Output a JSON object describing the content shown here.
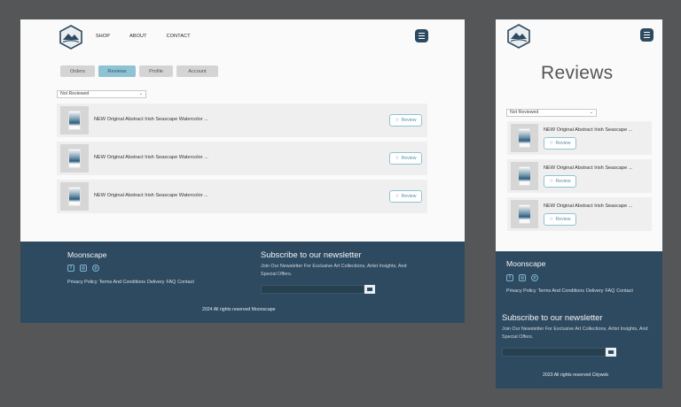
{
  "colors": {
    "accent": "#8fc3d3",
    "footer": "#2e4a60",
    "canvas": "#555657",
    "icon": "#7fb4d2"
  },
  "desktop": {
    "logo_icon": "mountain-hexagon-logo",
    "nav": [
      "SHOP",
      "ABOUT",
      "CONTACT"
    ],
    "menu_icon": "hamburger-icon",
    "tabs": [
      {
        "label": "Orders",
        "active": false
      },
      {
        "label": "Reviews",
        "active": true
      },
      {
        "label": "Profile",
        "active": false
      },
      {
        "label": "Account",
        "active": false
      }
    ],
    "filter": {
      "selected": "Not Reviewed"
    },
    "items": [
      {
        "title": "NEW Original Abstract Irish Seascape Watercolor ...",
        "action": "Review"
      },
      {
        "title": "NEW Original Abstract Irish Seascape Watercolor ...",
        "action": "Review"
      },
      {
        "title": "NEW Original Abstract Irish Seascape Watercolor ...",
        "action": "Review"
      }
    ],
    "footer": {
      "brand": "Moonscape",
      "social_icons": [
        "facebook-icon",
        "instagram-icon",
        "pinterest-icon"
      ],
      "links": [
        "Privacy Policy",
        "Terms And Conditions",
        "Delivery",
        "FAQ",
        "Contact"
      ],
      "newsletter_title": "Subscribe to our newsletter",
      "newsletter_desc": "Join Our Newsletter For Exclusive Art Collections, Artist Insights, And Special Offers.",
      "copyright": "2024 All rights reserved Moonscape"
    }
  },
  "mobile": {
    "page_title": "Reviews",
    "filter": {
      "selected": "Not Reviewed"
    },
    "items": [
      {
        "title": "NEW Original Abstract Irish Seascape ...",
        "action": "Review"
      },
      {
        "title": "NEW Original Abstract Irish Seascape ...",
        "action": "Review"
      },
      {
        "title": "NEW Original Abstract Irish Seascape ...",
        "action": "Review"
      }
    ],
    "footer": {
      "brand": "Moonscape",
      "links": [
        "Privacy Policy",
        "Terms And Conditions",
        "Delivery",
        "FAQ",
        "Contact"
      ],
      "newsletter_title": "Subscribe to our newsletter",
      "newsletter_desc": "Join Our Newsletter For Exclusive Art Collections, Artist Insights, And Special Offers.",
      "copyright": "2023 All rights reserved Cityweb"
    }
  }
}
